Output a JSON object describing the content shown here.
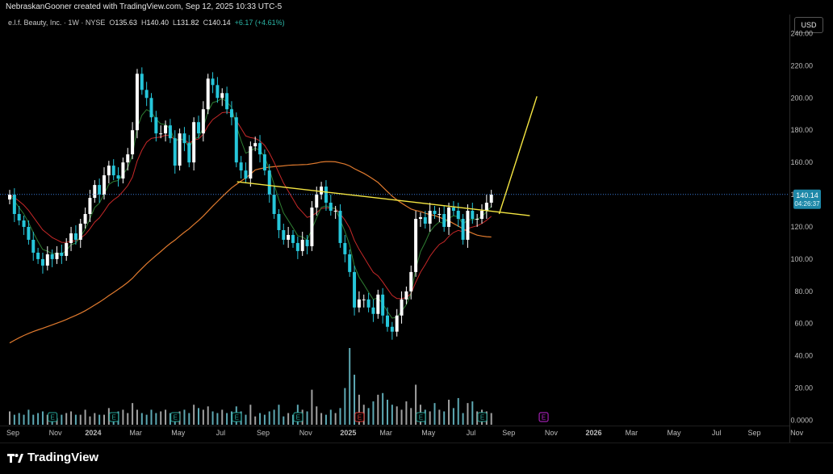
{
  "header": {
    "credit": "NebraskanGooner created with TradingView.com, Sep 12, 2025 10:33 UTC-5",
    "legend_name": "e.l.f. Beauty, Inc. · 1W · NYSE",
    "o_label": "O",
    "o_value": "135.63",
    "h_label": "H",
    "h_value": "140.40",
    "l_label": "L",
    "l_value": "131.82",
    "c_label": "C",
    "c_value": "140.14",
    "change": "+6.17 (+4.61%)"
  },
  "currency": "USD",
  "price_badge": {
    "price": "140.14",
    "countdown": "04:26:37"
  },
  "footer": {
    "brand": "TradingView"
  },
  "colors": {
    "up": "#ffffff",
    "down": "#26c6da",
    "ma_fast": "#2e7d32",
    "ma_mid": "#c62828",
    "ma_slow": "#e07a2e",
    "trendline": "#f5e642",
    "earnings": "#26a69a",
    "earnings_next": "#c026d3"
  },
  "chart_data": {
    "type": "candlestick",
    "title": "",
    "ylim": [
      0,
      245
    ],
    "y_ticks": [
      "240.00",
      "220.00",
      "200.00",
      "180.00",
      "160.00",
      "140.00",
      "120.00",
      "100.00",
      "80.00",
      "60.00",
      "40.00",
      "20.00",
      "0.0000"
    ],
    "x_ticks": [
      {
        "label": "Sep",
        "week": 0
      },
      {
        "label": "Nov",
        "week": 9
      },
      {
        "label": "2024",
        "week": 17
      },
      {
        "label": "Mar",
        "week": 26
      },
      {
        "label": "May",
        "week": 35
      },
      {
        "label": "Jul",
        "week": 44
      },
      {
        "label": "Sep",
        "week": 53
      },
      {
        "label": "Nov",
        "week": 62
      },
      {
        "label": "2025",
        "week": 71
      },
      {
        "label": "Mar",
        "week": 79
      },
      {
        "label": "May",
        "week": 88
      },
      {
        "label": "Jul",
        "week": 97
      },
      {
        "label": "Sep",
        "week": 105
      },
      {
        "label": "Nov",
        "week": 114
      },
      {
        "label": "2026",
        "week": 123
      },
      {
        "label": "Mar",
        "week": 131
      },
      {
        "label": "May",
        "week": 140
      },
      {
        "label": "Jul",
        "week": 149
      },
      {
        "label": "Sep",
        "week": 157
      },
      {
        "label": "Nov",
        "week": 166
      }
    ],
    "closes": [
      140,
      128,
      124,
      120,
      112,
      104,
      100,
      96,
      103,
      100,
      104,
      102,
      110,
      116,
      112,
      122,
      128,
      138,
      146,
      140,
      152,
      158,
      152,
      150,
      160,
      165,
      180,
      215,
      205,
      200,
      188,
      178,
      178,
      183,
      175,
      158,
      178,
      172,
      160,
      185,
      178,
      193,
      212,
      208,
      200,
      203,
      193,
      188,
      160,
      155,
      150,
      170,
      172,
      165,
      155,
      140,
      128,
      118,
      112,
      115,
      110,
      105,
      112,
      108,
      132,
      140,
      145,
      135,
      130,
      130,
      110,
      103,
      92,
      70,
      75,
      75,
      70,
      66,
      78,
      65,
      58,
      55,
      65,
      75,
      80,
      92,
      125,
      126,
      122,
      130,
      128,
      128,
      120,
      132,
      130,
      125,
      112,
      130,
      125,
      125,
      130,
      135,
      140
    ],
    "volumes": [
      8,
      6,
      7,
      6,
      9,
      6,
      7,
      8,
      6,
      5,
      4,
      6,
      7,
      8,
      6,
      6,
      9,
      5,
      7,
      6,
      6,
      10,
      6,
      8,
      9,
      7,
      13,
      9,
      7,
      6,
      9,
      7,
      8,
      9,
      7,
      6,
      8,
      9,
      7,
      12,
      10,
      9,
      11,
      8,
      7,
      9,
      7,
      8,
      11,
      8,
      6,
      12,
      5,
      7,
      6,
      8,
      9,
      12,
      5,
      7,
      6,
      12,
      9,
      8,
      21,
      11,
      7,
      6,
      9,
      7,
      10,
      22,
      46,
      30,
      18,
      12,
      10,
      14,
      18,
      19,
      15,
      12,
      11,
      9,
      14,
      10,
      24,
      12,
      9,
      8,
      13,
      9,
      8,
      15,
      10,
      16,
      7,
      13,
      14,
      8,
      9,
      8,
      7
    ],
    "ma_fast": [],
    "ma_mid": [],
    "ma_slow": [],
    "trendline": {
      "from": {
        "week": 48.5,
        "price": 148
      },
      "to": {
        "week": 110.5,
        "price": 127
      }
    },
    "projection": {
      "from": {
        "week": 104,
        "price": 128
      },
      "to": {
        "week": 112,
        "price": 201
      }
    },
    "earnings_weeks": [
      9,
      22,
      35,
      48,
      61
    ],
    "earnings_flag_weeks": [
      74
    ],
    "earnings_after_weeks": [
      87,
      100
    ],
    "earnings_next_week": [
      113
    ]
  }
}
